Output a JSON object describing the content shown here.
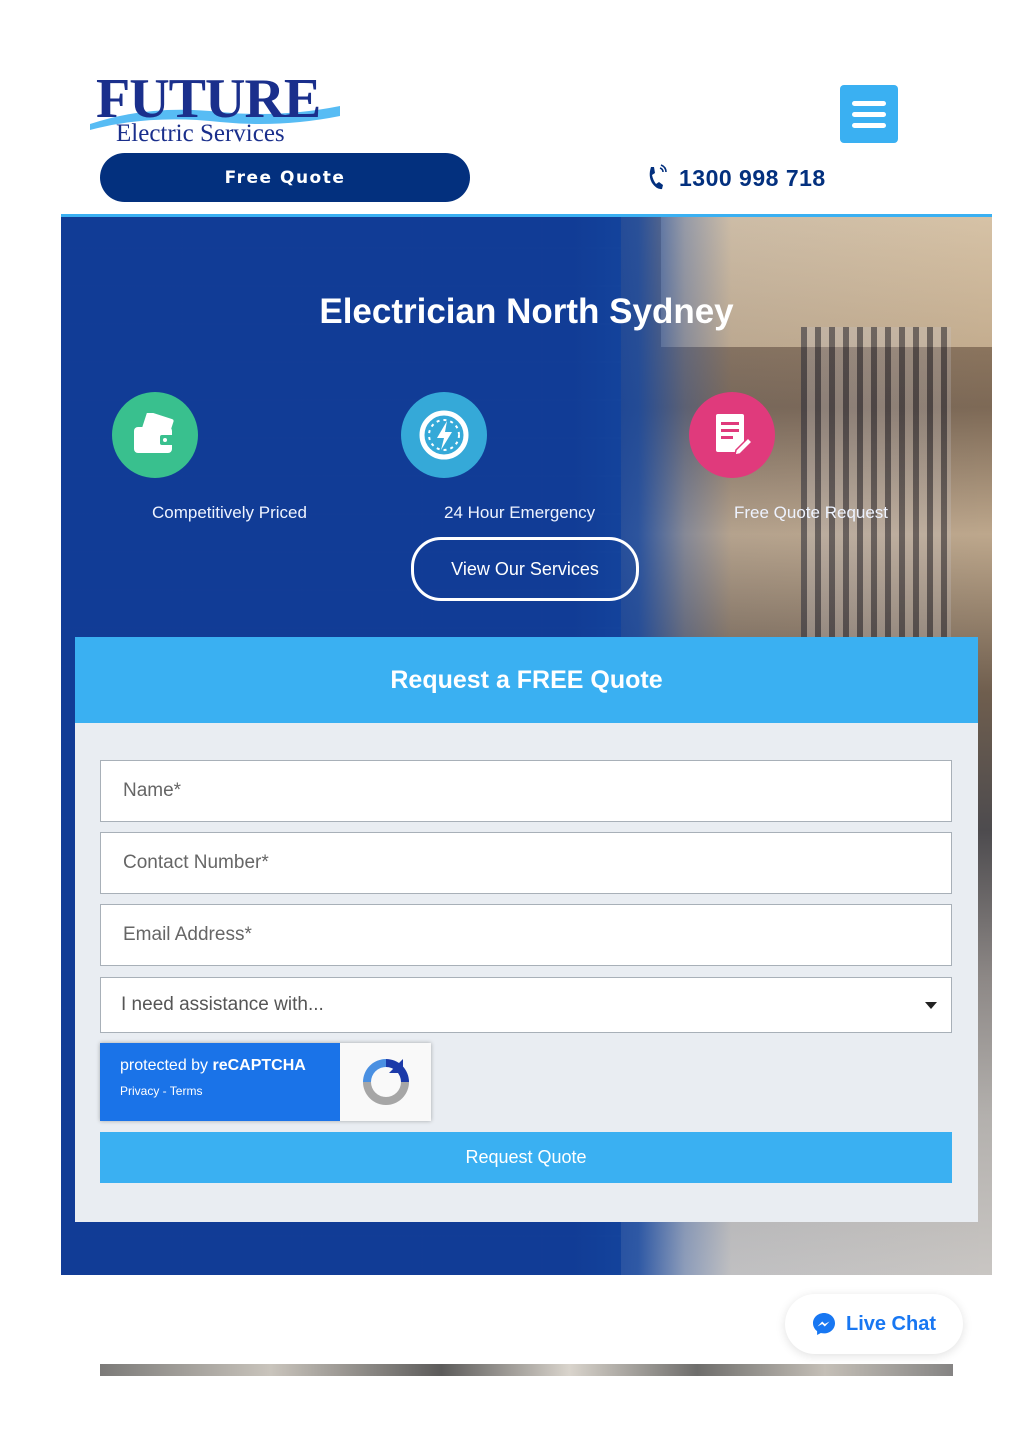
{
  "header": {
    "logo_main": "FUTURE",
    "logo_sub": "Electric Services",
    "free_quote_label": "Free Quote",
    "phone_number": "1300 998 718"
  },
  "hero": {
    "title": "Electrician North Sydney",
    "features": [
      {
        "label": "Competitively Priced",
        "icon": "wallet-icon",
        "color": "#39c08e"
      },
      {
        "label": "24 Hour Emergency",
        "icon": "power-clock-icon",
        "color": "#35a9d8"
      },
      {
        "label": "Free Quote Request",
        "icon": "document-pencil-icon",
        "color": "#e03a7c"
      }
    ],
    "view_services_label": "View Our Services"
  },
  "form": {
    "title": "Request a FREE Quote",
    "name_placeholder": "Name*",
    "contact_placeholder": "Contact Number*",
    "email_placeholder": "Email Address*",
    "select_value": "I need assistance with...",
    "recaptcha_line1_prefix": "protected by ",
    "recaptcha_line1_brand": "reCAPTCHA",
    "recaptcha_line2": "Privacy - Terms",
    "submit_label": "Request Quote"
  },
  "live_chat": {
    "label": "Live Chat",
    "icon": "messenger-icon"
  },
  "colors": {
    "navy": "#03307e",
    "accent": "#3ab0f2",
    "hero_blue": "#14408f",
    "messenger": "#1877f2"
  }
}
